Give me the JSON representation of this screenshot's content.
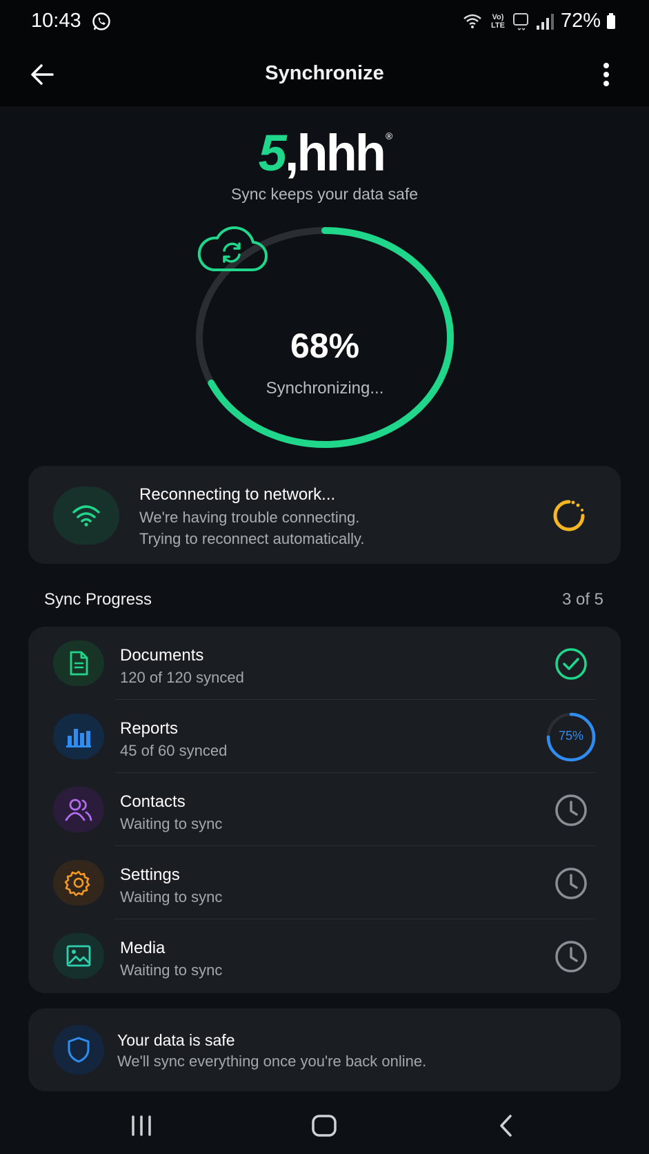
{
  "status_bar": {
    "time": "10:43",
    "battery": "72%",
    "volte_line1": "Vo)",
    "volte_line2": "LTE",
    "icons": [
      "whatsapp-icon",
      "wifi-call-icon",
      "volte-icon",
      "5g-icon",
      "signal-icon",
      "battery-icon"
    ]
  },
  "header": {
    "title": "Synchronize",
    "icons": [
      "back-arrow-icon",
      "more-vert-icon"
    ]
  },
  "brand": {
    "logo_part1": "5",
    "logo_part2": ",hhh",
    "registered": "®",
    "tagline": "Sync keeps your data safe"
  },
  "progress": {
    "percent_label": "68%",
    "percent_value": 0.68,
    "status": "Synchronizing...",
    "icon": "cloud-sync-icon"
  },
  "network_alert": {
    "title": "Reconnecting to network...",
    "line1": "We're having trouble connecting.",
    "line2": "Trying to reconnect automatically.",
    "icon": "wifi-icon",
    "status_icon": "spinner-icon"
  },
  "sync_progress": {
    "title": "Sync Progress",
    "count": "3 of 5",
    "items": [
      {
        "title": "Documents",
        "subtitle": "120 of 120 synced",
        "status": "done",
        "icon": "document-icon"
      },
      {
        "title": "Reports",
        "subtitle": "45 of 60 synced",
        "status": "in-progress",
        "percent_label": "75%",
        "percent_value": 0.75,
        "icon": "bar-chart-icon"
      },
      {
        "title": "Contacts",
        "subtitle": "Waiting to sync",
        "status": "waiting",
        "icon": "contacts-icon"
      },
      {
        "title": "Settings",
        "subtitle": "Waiting to sync",
        "status": "waiting",
        "icon": "gear-icon"
      },
      {
        "title": "Media",
        "subtitle": "Waiting to sync",
        "status": "waiting",
        "icon": "image-icon"
      }
    ]
  },
  "safe_notice": {
    "title": "Your data is safe",
    "subtitle": "We'll sync everything once you're back online.",
    "icon": "shield-icon"
  },
  "colors": {
    "accent_green": "#1fd68a",
    "accent_blue": "#2f8cf0",
    "warning_yellow": "#f5b622",
    "purple": "#b46cf0",
    "orange": "#f59a23",
    "teal": "#2fd0b0",
    "background": "#0d1014",
    "card": "#1a1e23"
  },
  "nav_bar": {
    "icons": [
      "recent-apps-icon",
      "home-icon",
      "nav-back-icon"
    ]
  }
}
